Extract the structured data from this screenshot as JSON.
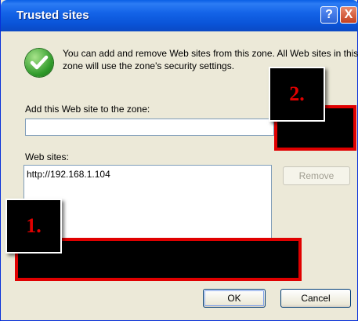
{
  "window": {
    "title": "Trusted sites"
  },
  "titlebar_buttons": {
    "help": "?",
    "close": "X"
  },
  "info": {
    "icon": "check-icon",
    "text": "You can add and remove Web sites from this zone. All Web sites in this zone will use the zone's security settings."
  },
  "add_site": {
    "label": "Add this Web site to the zone:",
    "value": ""
  },
  "web_sites": {
    "label": "Web sites:",
    "items": [
      "http://192.168.1.104"
    ]
  },
  "buttons": {
    "remove": "Remove",
    "ok": "OK",
    "cancel": "Cancel"
  },
  "annotations": [
    {
      "label": "1."
    },
    {
      "label": "2."
    }
  ],
  "colors": {
    "titlebar": "#0a54d8",
    "annotation_red": "#e00000",
    "window_bg": "#ece9d8"
  }
}
